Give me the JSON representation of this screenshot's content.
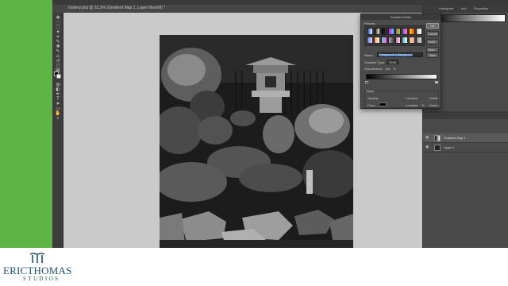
{
  "document": {
    "tab_title": "Gallery.psd @ 33.3% (Gradient Map 1, Layer Mask/8) *"
  },
  "toolbar": {
    "tools": [
      "move-icon",
      "marquee-icon",
      "lasso-icon",
      "wand-icon",
      "crop-icon",
      "eyedropper-icon",
      "healing-icon",
      "brush-icon",
      "stamp-icon",
      "history-brush-icon",
      "eraser-icon",
      "gradient-icon",
      "blur-icon",
      "dodge-icon",
      "pen-icon",
      "type-icon",
      "path-select-icon",
      "shape-icon",
      "hand-icon",
      "zoom-icon"
    ]
  },
  "panels": {
    "tabs": [
      "Histogram",
      "Info",
      "Properties"
    ]
  },
  "dialog": {
    "title": "Gradient Editor",
    "presets_label": "Presets",
    "preset_colors": [
      [
        "#0a3cff",
        "#ffffff"
      ],
      [
        "#000000",
        "#ffffff"
      ],
      [
        "#000000",
        "#00000000"
      ],
      [
        "#ff00ff",
        "#00ffff"
      ],
      [
        "#ff4444",
        "#44ff44"
      ],
      [
        "#8844ff",
        "#ff88aa"
      ],
      [
        "#ffdd00",
        "#ff3300"
      ],
      [
        "#c8c8c8",
        "#ffffff"
      ],
      [
        "#4488ff",
        "#ffccee"
      ],
      [
        "#ff9944",
        "#ffffff"
      ],
      [
        "#44ccff",
        "#ff66cc"
      ],
      [
        "#aaaaaa",
        "#444444"
      ],
      [
        "#ff6699",
        "#ffddee"
      ],
      [
        "#33bbff",
        "#ffffff"
      ],
      [
        "#ffcc66",
        "#ff99cc"
      ],
      [
        "#888888",
        "#dddddd"
      ]
    ],
    "buttons": {
      "ok": "OK",
      "cancel": "Cancel",
      "load": "Load...",
      "save": "Save..."
    },
    "name_label": "Name:",
    "name_value": "Foreground to Background",
    "new_button": "New",
    "gradient_type_label": "Gradient Type:",
    "gradient_type_value": "Solid",
    "smoothness_label": "Smoothness:",
    "smoothness_value": "100",
    "smoothness_unit": "%",
    "stops_label": "Stops",
    "opacity_label": "Opacity:",
    "color_label": "Color:",
    "location_label": "Location:",
    "location_unit": "%",
    "delete_button": "Delete"
  },
  "layers": {
    "rows": [
      {
        "name": "Gradient Map 1",
        "thumb": "grad",
        "selected": true
      },
      {
        "name": "Layer 1",
        "thumb": "dark",
        "selected": false
      }
    ]
  },
  "branding": {
    "name": "ERICTHOMAS",
    "sub": "STUDIOS",
    "color": "#1d4f6e"
  },
  "colors": {
    "green": "#5fb544",
    "canvas_bg": "#cacaca"
  }
}
